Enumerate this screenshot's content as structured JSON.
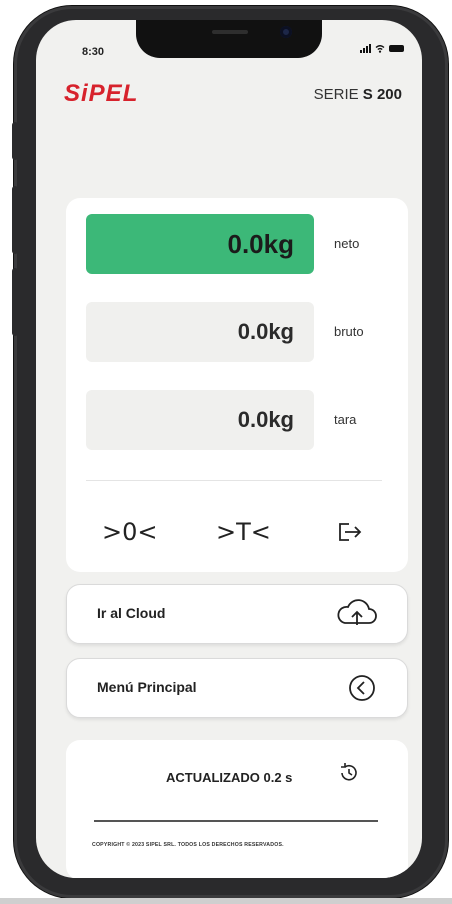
{
  "status": {
    "time": "8:30"
  },
  "header": {
    "brand": "SiPEL",
    "serie_prefix": "SERIE",
    "serie_model": "S 200"
  },
  "readings": [
    {
      "value": "0.0kg",
      "label": "neto"
    },
    {
      "value": "0.0kg",
      "label": "bruto"
    },
    {
      "value": "0.0kg",
      "label": "tara"
    }
  ],
  "actions": {
    "zero": ">0<",
    "tare": ">T<"
  },
  "buttons": {
    "cloud": "Ir al Cloud",
    "menu": "Menú Principal"
  },
  "footer": {
    "updated": "ACTUALIZADO 0.2 s",
    "copyright": "COPYRIGHT © 2023 SIPEL SRL. TODOS LOS DERECHOS RESERVADOS."
  },
  "colors": {
    "accent_green": "#3cb878",
    "brand_red": "#d7222c"
  },
  "icons": {
    "exit": "exit-icon",
    "cloud": "cloud-upload-icon",
    "back": "chevron-left-circle-icon",
    "history": "history-icon"
  }
}
